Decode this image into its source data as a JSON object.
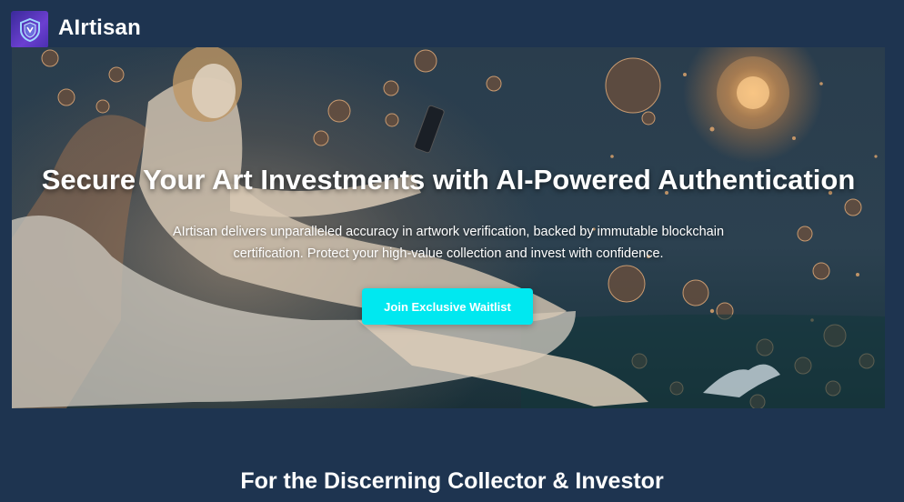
{
  "header": {
    "logo_icon": "shield-icon",
    "brand_name": "AIrtisan"
  },
  "hero": {
    "headline": "Secure Your Art Investments with AI-Powered Authentication",
    "subtext": "AIrtisan delivers unparalleled accuracy in artwork verification, backed by immutable blockchain certification. Protect your high-value collection and invest with confidence.",
    "cta_label": "Join Exclusive Waitlist",
    "image_icon": "classical-sculpture-with-phone-image"
  },
  "section": {
    "title": "For the Discerning Collector & Investor"
  },
  "colors": {
    "page_background": "#1e3450",
    "cta_background": "#00e8f0",
    "logo_gradient": "#6b3fd0"
  }
}
